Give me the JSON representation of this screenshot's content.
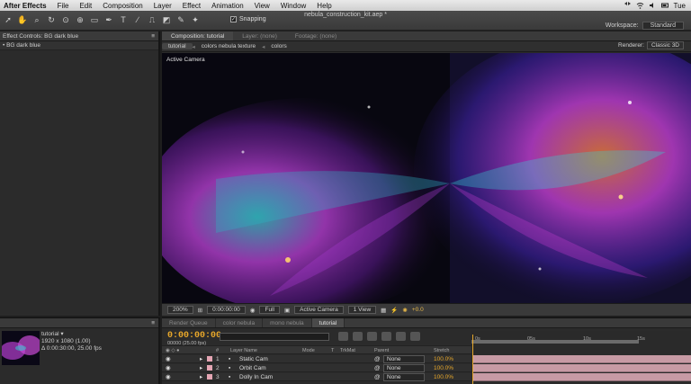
{
  "menubar": {
    "app_name": "After Effects",
    "items": [
      "File",
      "Edit",
      "Composition",
      "Layer",
      "Effect",
      "Animation",
      "View",
      "Window",
      "Help"
    ],
    "clock": "Tue"
  },
  "toolbar": {
    "title": "nebula_construction_kit.aep *",
    "snapping_label": "Snapping",
    "snapping_checked": true,
    "workspace_label": "Workspace:",
    "workspace_value": "Standard"
  },
  "effect_controls": {
    "tab_label": "Effect Controls: BG dark blue",
    "layer_label": "• BG dark blue"
  },
  "composition_panel": {
    "tabs": [
      "Composition: tutorial",
      "Layer: (none)",
      "Footage: (none)"
    ],
    "breadcrumbs": [
      "tutorial",
      "colors nebula texture",
      "colors"
    ],
    "renderer_label": "Renderer:",
    "renderer_value": "Classic 3D",
    "viewer_label": "Active Camera",
    "bar": {
      "zoom": "200%",
      "timecode": "0:00:00:00",
      "resolution": "Full",
      "camera": "Active Camera",
      "view": "1 View",
      "exposure": "+0.0"
    }
  },
  "project_panel": {
    "comp_name": "tutorial ▾",
    "dimensions": "1920 x 1080 (1.00)",
    "duration": "Δ 0:00:30:00, 25.00 fps"
  },
  "timeline": {
    "tabs": [
      "Render Queue",
      "color nebula",
      "mono nebula",
      "tutorial"
    ],
    "active_tab": "tutorial",
    "timecode": "0:00:00:00",
    "frames_label": "00000 (25.00 fps)",
    "columns": {
      "layer_name": "Layer Name",
      "mode": "Mode",
      "t": "T",
      "trkmat": "TrkMat",
      "parent": "Parent",
      "stretch": "Stretch"
    },
    "ruler_ticks": [
      "0s",
      "05s",
      "10s",
      "15s"
    ],
    "layers": [
      {
        "num": "1",
        "name": "Static Cam",
        "parent": "None",
        "stretch": "100.0%"
      },
      {
        "num": "2",
        "name": "Orbit Cam",
        "parent": "None",
        "stretch": "100.0%"
      },
      {
        "num": "3",
        "name": "Dolly In Cam",
        "parent": "None",
        "stretch": "100.0%"
      }
    ]
  },
  "colors": {
    "accent_orange": "#e7a72a",
    "layer_bar_pink": "#c79aa4"
  }
}
